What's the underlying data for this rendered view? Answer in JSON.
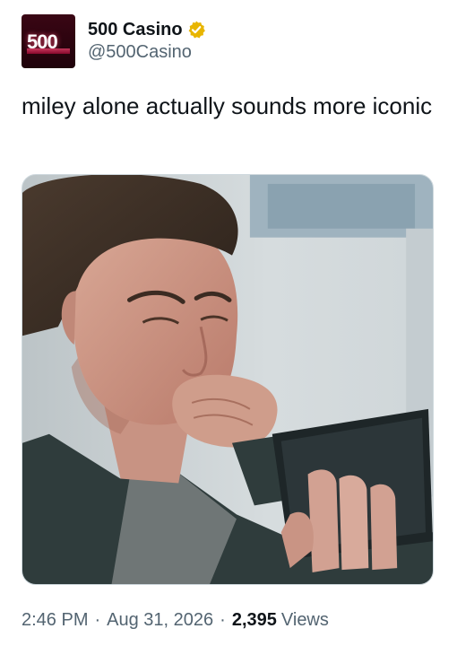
{
  "author": {
    "display_name": "500 Casino",
    "handle": "@500Casino",
    "avatar_text": "500",
    "verified_color": "#e8b500"
  },
  "tweet": {
    "text": "miley alone actually sounds more iconic"
  },
  "media": {
    "icon": "photo-of-man-looking-at-tablet"
  },
  "meta": {
    "time": "2:46 PM",
    "date": "Aug 31, 2026",
    "separator": "·",
    "views_count": "2,395",
    "views_label": "Views"
  },
  "colors": {
    "text_primary": "#0f1419",
    "text_secondary": "#536471",
    "border": "#cfd9de"
  }
}
